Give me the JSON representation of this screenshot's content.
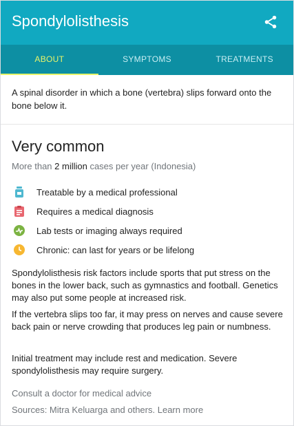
{
  "header": {
    "title": "Spondylolisthesis",
    "share_icon": "share-icon"
  },
  "tabs": [
    {
      "label": "ABOUT",
      "active": true
    },
    {
      "label": "SYMPTOMS",
      "active": false
    },
    {
      "label": "TREATMENTS",
      "active": false
    }
  ],
  "description": "A spinal disorder in which a bone (vertebra) slips forward onto the bone below it.",
  "prevalence": {
    "heading": "Very common",
    "prefix": "More than ",
    "amount": "2 million",
    "suffix": " cases per year (Indonesia)"
  },
  "facts": [
    {
      "icon": "medicine-bottle-icon",
      "color": "#4fb8d0",
      "text": "Treatable by a medical professional"
    },
    {
      "icon": "clipboard-icon",
      "color": "#e8666f",
      "text": "Requires a medical diagnosis"
    },
    {
      "icon": "lab-test-icon",
      "color": "#7cb342",
      "text": "Lab tests or imaging always required"
    },
    {
      "icon": "clock-icon",
      "color": "#f7b731",
      "text": "Chronic: can last for years or be lifelong"
    }
  ],
  "paragraphs": [
    "Spondylolisthesis risk factors include sports that put stress on the bones in the lower back, such as gymnastics and football. Genetics may also put some people at increased risk.",
    "If the vertebra slips too far, it may press on nerves and cause severe back pain or nerve crowding that produces leg pain or numbness.",
    "Initial treatment may include rest and medication. Severe spondylolisthesis may require surgery."
  ],
  "footer": {
    "consult": "Consult a doctor for medical advice",
    "sources": "Sources: Mitra Keluarga and others.",
    "learn_more": "Learn more"
  },
  "colors": {
    "header": "#11a9c1",
    "tabs": "#0d8fa3",
    "active_tab": "#e8f56a"
  }
}
